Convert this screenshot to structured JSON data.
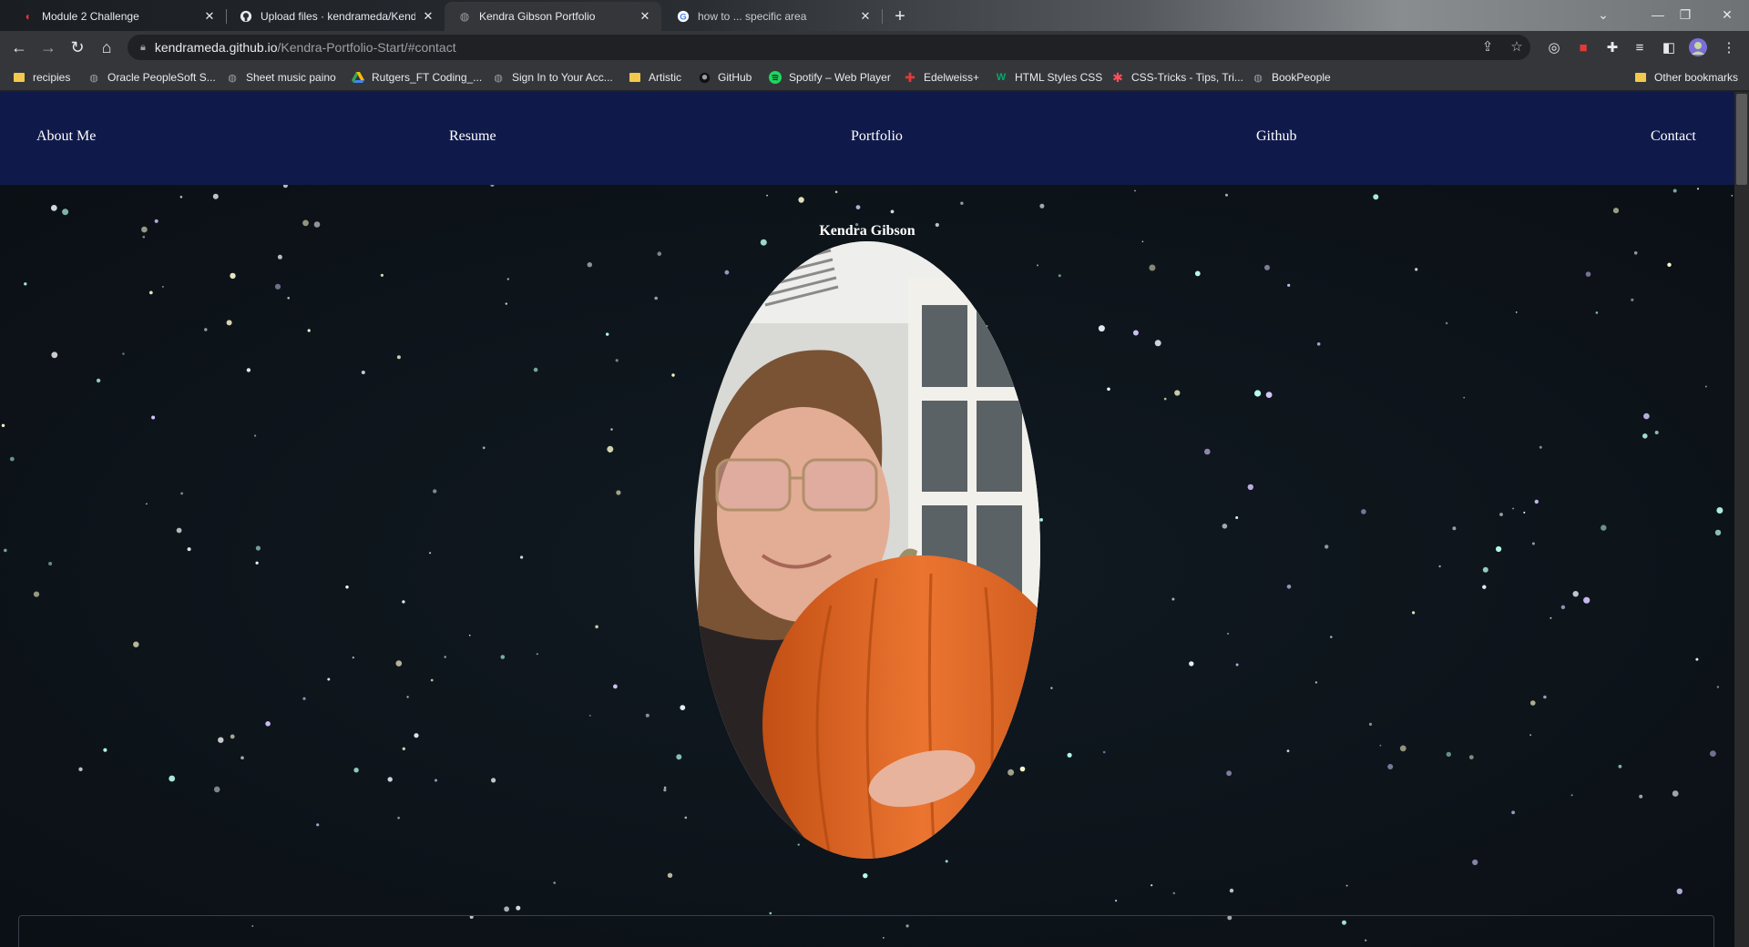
{
  "browser": {
    "tabs": [
      {
        "title": "Module 2 Challenge",
        "icon": "canvas-icon",
        "active": false
      },
      {
        "title": "Upload files · kendrameda/Kendi",
        "icon": "github-icon",
        "active": false
      },
      {
        "title": "Kendra Gibson Portfolio",
        "icon": "globe-icon",
        "active": true
      },
      {
        "title": "how to ... specific area",
        "icon": "google-icon",
        "active": false
      }
    ],
    "url_host": "kendrameda.github.io",
    "url_path": "/Kendra-Portfolio-Start/#contact",
    "bookmarks": [
      {
        "label": "recipies",
        "icon": "folder-icon"
      },
      {
        "label": "Oracle PeopleSoft S...",
        "icon": "globe-icon"
      },
      {
        "label": "Sheet music paino",
        "icon": "globe-icon"
      },
      {
        "label": "Rutgers_FT Coding_...",
        "icon": "drive-icon"
      },
      {
        "label": "Sign In to Your Acc...",
        "icon": "globe-icon"
      },
      {
        "label": "Artistic",
        "icon": "folder-icon"
      },
      {
        "label": "GitHub",
        "icon": "github-icon"
      },
      {
        "label": "Spotify – Web Player",
        "icon": "spotify-icon"
      },
      {
        "label": "Edelweiss+",
        "icon": "edelweiss-icon"
      },
      {
        "label": "HTML Styles CSS",
        "icon": "w3schools-icon"
      },
      {
        "label": "CSS-Tricks - Tips, Tri...",
        "icon": "csstricks-icon"
      },
      {
        "label": "BookPeople",
        "icon": "globe-icon"
      }
    ],
    "other_bookmarks": "Other bookmarks"
  },
  "site": {
    "nav": [
      "About Me",
      "Resume",
      "Portfolio",
      "Github",
      "Contact"
    ],
    "hero_name": "Kendra Gibson"
  },
  "colors": {
    "nav_bg": "#101a4a",
    "page_bg": "#0d1319",
    "pumpkin": "#e0631f"
  }
}
